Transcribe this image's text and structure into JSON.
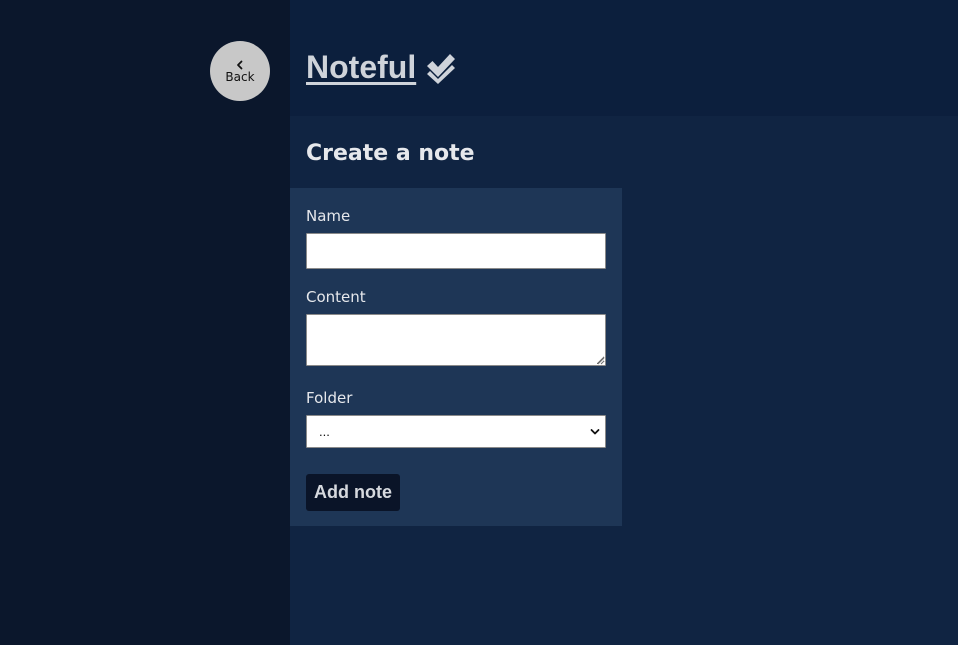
{
  "nav": {
    "back_label": "Back"
  },
  "header": {
    "brand": "Noteful"
  },
  "main": {
    "title": "Create a note"
  },
  "form": {
    "name_label": "Name",
    "name_value": "",
    "content_label": "Content",
    "content_value": "",
    "folder_label": "Folder",
    "folder_selected": "...",
    "submit_label": "Add note"
  },
  "icons": {
    "back": "chevron-left-icon",
    "brand": "double-check-icon",
    "select": "chevron-down-icon"
  },
  "colors": {
    "sidebar_bg": "#0b172c",
    "header_bg": "#0c1f3d",
    "main_bg": "#102442",
    "form_bg": "#1e3656",
    "button_bg": "#0a1428",
    "back_button_bg": "#c8c8c8",
    "text": "#e6e8ec"
  }
}
